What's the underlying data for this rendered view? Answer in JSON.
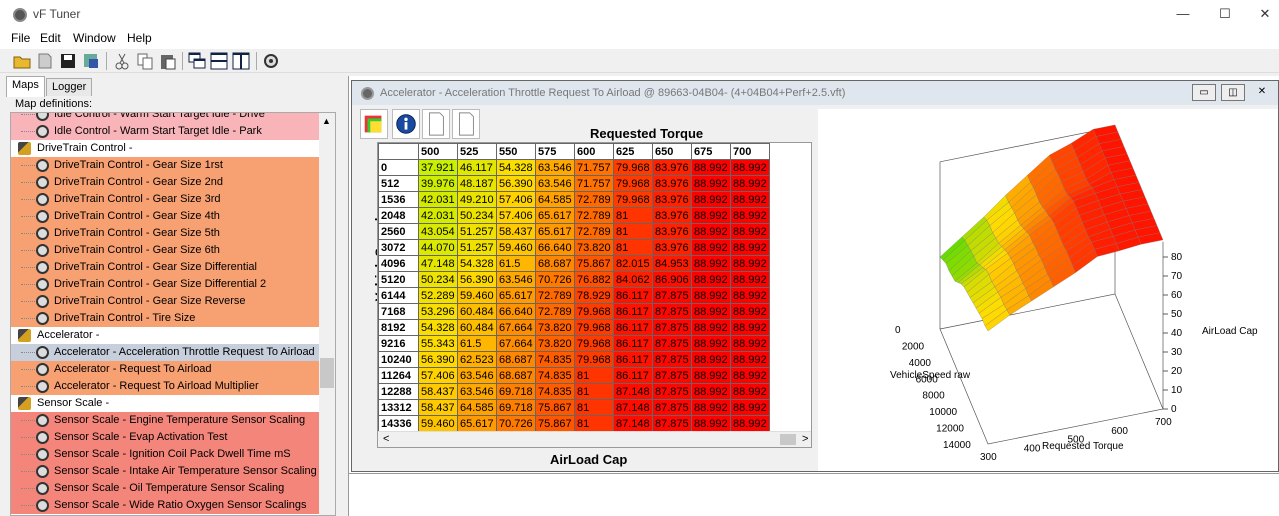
{
  "app": {
    "title": "vF Tuner"
  },
  "window_controls": {
    "minimize": "—",
    "maximize": "☐",
    "close": "✕"
  },
  "menu": [
    "File",
    "Edit",
    "Window",
    "Help"
  ],
  "left": {
    "tabs": [
      "Maps",
      "Logger"
    ],
    "map_definitions_label": "Map definitions:",
    "tree": [
      {
        "type": "item",
        "label": "Idle Control - Warm Start Target Idle - Drive",
        "color": "#f8b4b8"
      },
      {
        "type": "item",
        "label": "Idle Control - Warm Start Target Idle - Park",
        "color": "#f8b4b8"
      },
      {
        "type": "group",
        "label": "DriveTrain Control -"
      },
      {
        "type": "item",
        "label": "DriveTrain Control - Gear Size 1rst",
        "color": "#f7a072"
      },
      {
        "type": "item",
        "label": "DriveTrain Control - Gear Size 2nd",
        "color": "#f7a072"
      },
      {
        "type": "item",
        "label": "DriveTrain Control - Gear Size 3rd",
        "color": "#f7a072"
      },
      {
        "type": "item",
        "label": "DriveTrain Control - Gear Size 4th",
        "color": "#f7a072"
      },
      {
        "type": "item",
        "label": "DriveTrain Control - Gear Size 5th",
        "color": "#f7a072"
      },
      {
        "type": "item",
        "label": "DriveTrain Control - Gear Size 6th",
        "color": "#f7a072"
      },
      {
        "type": "item",
        "label": "DriveTrain Control - Gear Size Differential",
        "color": "#f7a072"
      },
      {
        "type": "item",
        "label": "DriveTrain Control - Gear Size Differential 2",
        "color": "#f7a072"
      },
      {
        "type": "item",
        "label": "DriveTrain Control - Gear Size Reverse",
        "color": "#f7a072"
      },
      {
        "type": "item",
        "label": "DriveTrain Control - Tire Size",
        "color": "#f7a072"
      },
      {
        "type": "group",
        "label": "Accelerator -"
      },
      {
        "type": "item",
        "label": "Accelerator - Acceleration Throttle Request To Airload",
        "color": "#c6cfdb",
        "selected": true
      },
      {
        "type": "item",
        "label": "Accelerator - Request To Airload",
        "color": "#f7a072"
      },
      {
        "type": "item",
        "label": "Accelerator - Request To Airload Multiplier",
        "color": "#f7a072"
      },
      {
        "type": "group",
        "label": "Sensor Scale -"
      },
      {
        "type": "item",
        "label": "Sensor Scale - Engine Temperature Sensor Scaling",
        "color": "#f4857a"
      },
      {
        "type": "item",
        "label": "Sensor Scale - Evap Activation Test",
        "color": "#f4857a"
      },
      {
        "type": "item",
        "label": "Sensor Scale - Ignition Coil Pack Dwell Time mS",
        "color": "#f4857a"
      },
      {
        "type": "item",
        "label": "Sensor Scale - Intake Air Temperature Sensor Scaling",
        "color": "#f4857a"
      },
      {
        "type": "item",
        "label": "Sensor Scale - Oil Temperature Sensor Scaling",
        "color": "#f4857a"
      },
      {
        "type": "item",
        "label": "Sensor Scale - Wide Ratio Oxygen Sensor Scalings",
        "color": "#f4857a"
      }
    ]
  },
  "child": {
    "title": "Accelerator - Acceleration Throttle Request To Airload @ 89663-04B04- (4+04B04+Perf+2.5.vft)",
    "column_axis_label": "Requested Torque",
    "row_axis_label": "VehicleSpeed raw",
    "value_label": "AirLoad Cap",
    "columns": [
      "500",
      "525",
      "550",
      "575",
      "600",
      "625",
      "650",
      "675",
      "700"
    ],
    "rows": [
      {
        "h": "0",
        "v": [
          "37.921",
          "46.117",
          "54.328",
          "63.546",
          "71.757",
          "79.968",
          "83.976",
          "88.992",
          "88.992"
        ]
      },
      {
        "h": "512",
        "v": [
          "39.976",
          "48.187",
          "56.390",
          "63.546",
          "71.757",
          "79.968",
          "83.976",
          "88.992",
          "88.992"
        ]
      },
      {
        "h": "1536",
        "v": [
          "42.031",
          "49.210",
          "57.406",
          "64.585",
          "72.789",
          "79.968",
          "83.976",
          "88.992",
          "88.992"
        ]
      },
      {
        "h": "2048",
        "v": [
          "42.031",
          "50.234",
          "57.406",
          "65.617",
          "72.789",
          "81",
          "83.976",
          "88.992",
          "88.992"
        ]
      },
      {
        "h": "2560",
        "v": [
          "43.054",
          "51.257",
          "58.437",
          "65.617",
          "72.789",
          "81",
          "83.976",
          "88.992",
          "88.992"
        ]
      },
      {
        "h": "3072",
        "v": [
          "44.070",
          "51.257",
          "59.460",
          "66.640",
          "73.820",
          "81",
          "83.976",
          "88.992",
          "88.992"
        ]
      },
      {
        "h": "4096",
        "v": [
          "47.148",
          "54.328",
          "61.5",
          "68.687",
          "75.867",
          "82.015",
          "84.953",
          "88.992",
          "88.992"
        ]
      },
      {
        "h": "5120",
        "v": [
          "50.234",
          "56.390",
          "63.546",
          "70.726",
          "76.882",
          "84.062",
          "86.906",
          "88.992",
          "88.992"
        ]
      },
      {
        "h": "6144",
        "v": [
          "52.289",
          "59.460",
          "65.617",
          "72.789",
          "78.929",
          "86.117",
          "87.875",
          "88.992",
          "88.992"
        ]
      },
      {
        "h": "7168",
        "v": [
          "53.296",
          "60.484",
          "66.640",
          "72.789",
          "79.968",
          "86.117",
          "87.875",
          "88.992",
          "88.992"
        ]
      },
      {
        "h": "8192",
        "v": [
          "54.328",
          "60.484",
          "67.664",
          "73.820",
          "79.968",
          "86.117",
          "87.875",
          "88.992",
          "88.992"
        ]
      },
      {
        "h": "9216",
        "v": [
          "55.343",
          "61.5",
          "67.664",
          "73.820",
          "79.968",
          "86.117",
          "87.875",
          "88.992",
          "88.992"
        ]
      },
      {
        "h": "10240",
        "v": [
          "56.390",
          "62.523",
          "68.687",
          "74.835",
          "79.968",
          "86.117",
          "87.875",
          "88.992",
          "88.992"
        ]
      },
      {
        "h": "11264",
        "v": [
          "57.406",
          "63.546",
          "68.687",
          "74.835",
          "81",
          "86.117",
          "87.875",
          "88.992",
          "88.992"
        ]
      },
      {
        "h": "12288",
        "v": [
          "58.437",
          "63.546",
          "69.718",
          "74.835",
          "81",
          "87.148",
          "87.875",
          "88.992",
          "88.992"
        ]
      },
      {
        "h": "13312",
        "v": [
          "58.437",
          "64.585",
          "69.718",
          "75.867",
          "81",
          "87.148",
          "87.875",
          "88.992",
          "88.992"
        ]
      },
      {
        "h": "14336",
        "v": [
          "59.460",
          "65.617",
          "70.726",
          "75.867",
          "81",
          "87.148",
          "87.875",
          "88.992",
          "88.992"
        ]
      }
    ],
    "scroll_left": "<",
    "scroll_right": ">"
  },
  "plot": {
    "z_label": "AirLoad Cap",
    "x_label": "Requested Torque",
    "y_label": "VehicleSpeed raw",
    "z_ticks": [
      "0",
      "10",
      "20",
      "30",
      "40",
      "50",
      "60",
      "70",
      "80"
    ],
    "x_ticks": [
      "300",
      "400",
      "500",
      "600",
      "700"
    ],
    "y_ticks": [
      "0",
      "2000",
      "4000",
      "6000",
      "8000",
      "10000",
      "12000",
      "14000"
    ]
  },
  "colors": {
    "cell_low": "#c8f000",
    "cell_mid": "#ffcc00",
    "cell_high": "#ff0000"
  }
}
